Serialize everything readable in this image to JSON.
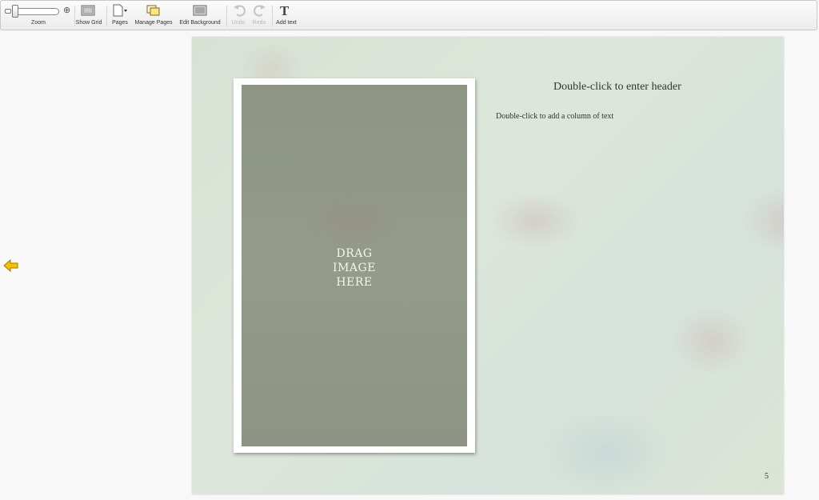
{
  "toolbar": {
    "zoom_label": "Zoom",
    "show_grid_label": "Show Grid",
    "pages_label": "Pages",
    "manage_pages_label": "Manage Pages",
    "edit_background_label": "Edit Background",
    "undo_label": "Undo",
    "redo_label": "Redo",
    "add_text_label": "Add text",
    "add_text_glyph": "T",
    "undo_enabled": false,
    "redo_enabled": false
  },
  "page": {
    "drag_image_lines": [
      "DRAG",
      "IMAGE",
      "HERE"
    ],
    "header_placeholder": "Double-click to enter header",
    "column_placeholder": "Double-click to add a column of text",
    "page_number": "5"
  },
  "icons": {
    "prev_page": "left-arrow-icon",
    "show_grid": "grid-icon",
    "pages": "page-icon",
    "manage_pages": "manage-pages-icon",
    "edit_background": "background-icon",
    "undo": "undo-icon",
    "redo": "redo-icon",
    "add_text": "text-icon"
  },
  "colors": {
    "nav_arrow": "#f2c200",
    "page_background": "#d9e4d8",
    "photo_slot": "#919886"
  }
}
